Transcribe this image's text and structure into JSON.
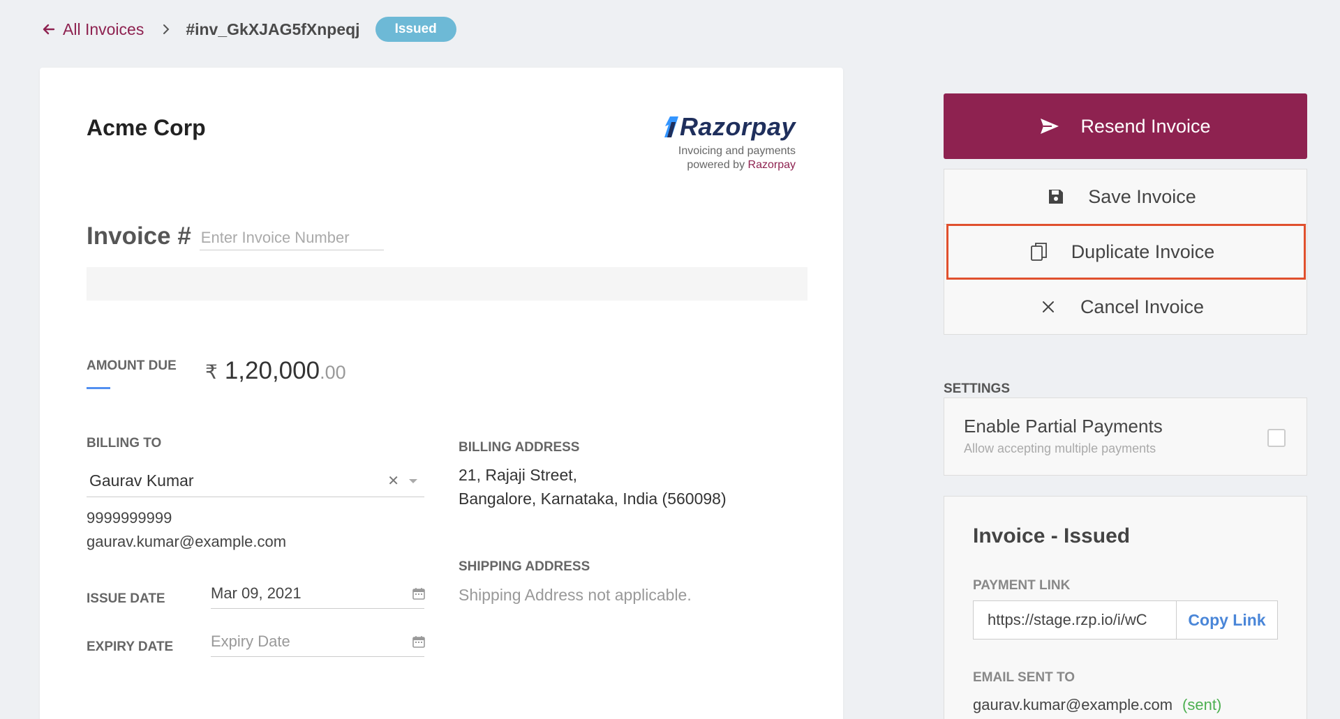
{
  "breadcrumb": {
    "back_label": "All Invoices",
    "invoice_id": "#inv_GkXJAG5fXnpeqj",
    "status_badge": "Issued"
  },
  "invoice": {
    "company": "Acme Corp",
    "brand": {
      "name": "Razorpay",
      "tagline_line1": "Invoicing and payments",
      "tagline_prefix": "powered by ",
      "tagline_link": "Razorpay"
    },
    "invoice_number_label": "Invoice #",
    "invoice_number_placeholder": "Enter Invoice Number",
    "amount_due_label": "AMOUNT DUE",
    "currency_symbol": "₹",
    "amount_whole": "1,20,000",
    "amount_decimal": ".00",
    "billing_to_label": "BILLING TO",
    "customer": {
      "name": "Gaurav Kumar",
      "phone": "9999999999",
      "email": "gaurav.kumar@example.com"
    },
    "issue_date_label": "ISSUE DATE",
    "issue_date_value": "Mar 09, 2021",
    "expiry_date_label": "EXPIRY DATE",
    "expiry_date_placeholder": "Expiry Date",
    "billing_address_label": "BILLING ADDRESS",
    "billing_address_line1": "21, Rajaji Street,",
    "billing_address_line2": "Bangalore, Karnataka, India (560098)",
    "shipping_address_label": "SHIPPING ADDRESS",
    "shipping_address_text": "Shipping Address not applicable."
  },
  "actions": {
    "resend": "Resend Invoice",
    "save": "Save Invoice",
    "duplicate": "Duplicate Invoice",
    "cancel": "Cancel Invoice"
  },
  "settings": {
    "label": "SETTINGS",
    "partial_title": "Enable Partial Payments",
    "partial_subtitle": "Allow accepting multiple payments",
    "partial_enabled": false
  },
  "status_panel": {
    "title": "Invoice - Issued",
    "payment_link_label": "PAYMENT LINK",
    "payment_link_value": "https://stage.rzp.io/i/wC",
    "copy_link_label": "Copy Link",
    "email_sent_label": "EMAIL SENT TO",
    "email_sent_value": "gaurav.kumar@example.com",
    "email_sent_status": "(sent)"
  },
  "colors": {
    "brand_primary": "#8e2250",
    "badge": "#6db9d6",
    "highlight_border": "#e0502e",
    "link_blue": "#4a86d8",
    "sent_green": "#4caf50"
  }
}
